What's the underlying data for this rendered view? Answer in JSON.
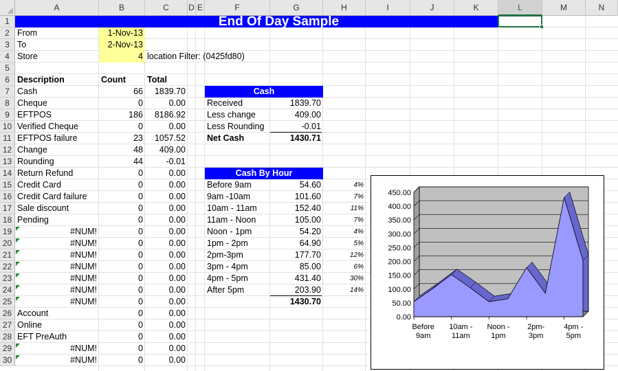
{
  "columns": [
    "A",
    "B",
    "C",
    "D",
    "E",
    "F",
    "G",
    "H",
    "I",
    "J",
    "K",
    "L",
    "M",
    "N"
  ],
  "rows": [
    "1",
    "2",
    "3",
    "4",
    "5",
    "6",
    "7",
    "8",
    "9",
    "10",
    "11",
    "12",
    "13",
    "14",
    "15",
    "16",
    "17",
    "18",
    "19",
    "20",
    "21",
    "22",
    "23",
    "24",
    "25",
    "26",
    "27",
    "28",
    "29",
    "30"
  ],
  "sheet": {
    "title": "End Of Day Sample",
    "from_label": "From",
    "from_value": "1-Nov-13",
    "to_label": "To",
    "to_value": "2-Nov-13",
    "store_label": "Store",
    "store_value": "4",
    "location_filter": "location Filter: (0425fd80)"
  },
  "table": {
    "headers": [
      "Description",
      "Count",
      "Total"
    ],
    "rows": [
      [
        "Cash",
        "66",
        "1839.70"
      ],
      [
        "Cheque",
        "0",
        "0.00"
      ],
      [
        "EFTPOS",
        "186",
        "8186.92"
      ],
      [
        "Verified Cheque",
        "0",
        "0.00"
      ],
      [
        "EFTPOS failure",
        "23",
        "1057.52"
      ],
      [
        "Change",
        "48",
        "409.00"
      ],
      [
        "Rounding",
        "44",
        "-0.01"
      ],
      [
        "Return Refund",
        "0",
        "0.00"
      ],
      [
        "Credit Card",
        "0",
        "0.00"
      ],
      [
        "Credit Card failure",
        "0",
        "0.00"
      ],
      [
        "Sale discount",
        "0",
        "0.00"
      ],
      [
        "Pending",
        "0",
        "0.00"
      ],
      [
        "#NUM!",
        "0",
        "0.00"
      ],
      [
        "#NUM!",
        "0",
        "0.00"
      ],
      [
        "#NUM!",
        "0",
        "0.00"
      ],
      [
        "#NUM!",
        "0",
        "0.00"
      ],
      [
        "#NUM!",
        "0",
        "0.00"
      ],
      [
        "#NUM!",
        "0",
        "0.00"
      ],
      [
        "#NUM!",
        "0",
        "0.00"
      ],
      [
        "Account",
        "0",
        "0.00"
      ],
      [
        "Online",
        "0",
        "0.00"
      ],
      [
        "EFT PreAuth",
        "0",
        "0.00"
      ],
      [
        "#NUM!",
        "0",
        "0.00"
      ],
      [
        "#NUM!",
        "0",
        "0.00"
      ]
    ]
  },
  "cash": {
    "title": "Cash",
    "rows": [
      [
        "Received",
        "1839.70"
      ],
      [
        "Less change",
        "409.00"
      ],
      [
        "Less Rounding",
        "-0.01"
      ]
    ],
    "net_label": "Net Cash",
    "net_value": "1430.71"
  },
  "cash_by_hour": {
    "title": "Cash By Hour",
    "rows": [
      [
        "Before 9am",
        "54.60",
        "4%"
      ],
      [
        "9am -10am",
        "101.60",
        "7%"
      ],
      [
        "10am - 11am",
        "152.40",
        "11%"
      ],
      [
        "11am - Noon",
        "105.00",
        "7%"
      ],
      [
        "Noon - 1pm",
        "54.20",
        "4%"
      ],
      [
        "1pm - 2pm",
        "64.90",
        "5%"
      ],
      [
        "2pm-3pm",
        "177.70",
        "12%"
      ],
      [
        "3pm - 4pm",
        "85.00",
        "6%"
      ],
      [
        "4pm - 5pm",
        "431.40",
        "30%"
      ],
      [
        "After 5pm",
        "203.90",
        "14%"
      ]
    ],
    "total": "1430.70"
  },
  "chart_data": {
    "type": "area",
    "categories": [
      "Before 9am",
      "9am -10am",
      "10am - 11am",
      "11am - Noon",
      "Noon - 1pm",
      "1pm - 2pm",
      "2pm-3pm",
      "3pm - 4pm",
      "4pm - 5pm",
      "After 5pm"
    ],
    "x_tick_labels": [
      [
        "Before",
        "9am"
      ],
      [
        "10am -",
        "11am"
      ],
      [
        "Noon -",
        "1pm"
      ],
      [
        "2pm-",
        "3pm"
      ],
      [
        "4pm -",
        "5pm"
      ]
    ],
    "values": [
      54.6,
      101.6,
      152.4,
      105.0,
      54.2,
      64.9,
      177.7,
      85.0,
      431.4,
      203.9
    ],
    "ylim": [
      0,
      450
    ],
    "yticks": [
      "0.00",
      "50.00",
      "100.00",
      "150.00",
      "200.00",
      "250.00",
      "300.00",
      "350.00",
      "400.00",
      "450.00"
    ],
    "grid": true,
    "colors": {
      "area": "#9999ff",
      "area_dark": "#6666cc",
      "wall": "#c0c0c0",
      "floor": "#808080"
    }
  },
  "colors": {
    "title_bg": "#0000ff",
    "input_bg": "#ffff99",
    "selection": "#217346"
  }
}
